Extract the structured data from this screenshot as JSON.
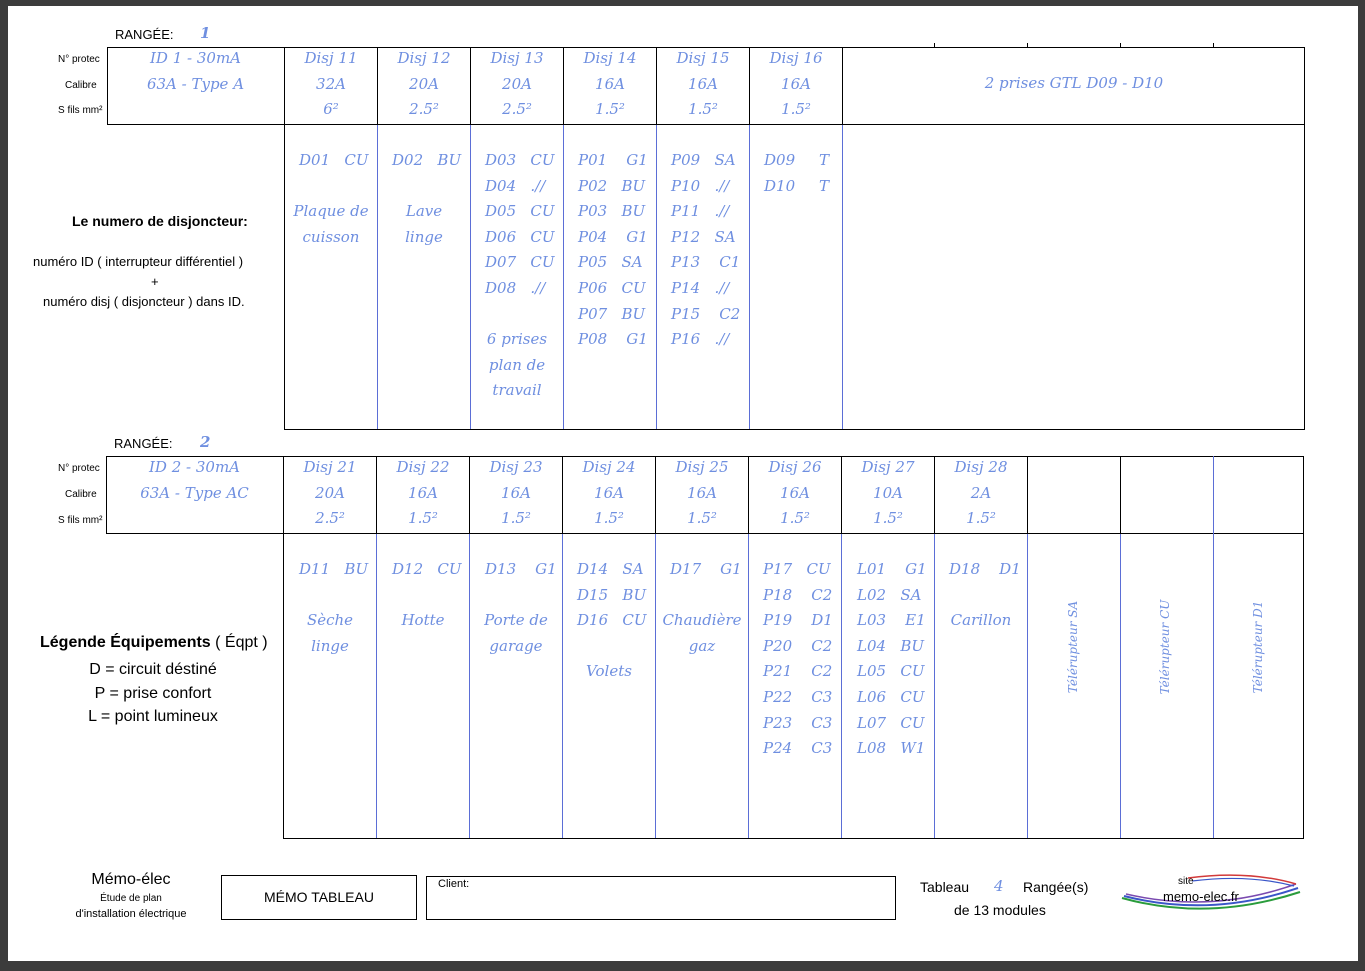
{
  "row1": {
    "label": "RANGÉE:",
    "number": "1",
    "side_labels": [
      "N° protec",
      "Calibre",
      "S fils mm²"
    ],
    "id_cell": [
      "ID 1  -  30mA",
      "63A  -  Type A"
    ],
    "breakers": [
      {
        "name": "Disj 11",
        "amp": "32A",
        "wire": "6²",
        "circuits": "D01   CU",
        "desc": "Plaque de\ncuisson"
      },
      {
        "name": "Disj 12",
        "amp": "20A",
        "wire": "2.5²",
        "circuits": "D02   BU",
        "desc": "Lave\nlinge"
      },
      {
        "name": "Disj 13",
        "amp": "20A",
        "wire": "2.5²",
        "circuits": "D03   CU\nD04   .//\nD05   CU\nD06   CU\nD07   CU\nD08   .//",
        "desc": "6 prises\nplan de\ntravail"
      },
      {
        "name": "Disj 14",
        "amp": "16A",
        "wire": "1.5²",
        "circuits": "P01    G1\nP02   BU\nP03   BU\nP04    G1\nP05   SA\nP06   CU\nP07   BU\nP08    G1",
        "desc": ""
      },
      {
        "name": "Disj 15",
        "amp": "16A",
        "wire": "1.5²",
        "circuits": "P09   SA\nP10   .//\nP11   .//\nP12   SA\nP13    C1\nP14   .//\nP15    C2\nP16   .//",
        "desc": ""
      },
      {
        "name": "Disj 16",
        "amp": "16A",
        "wire": "1.5²",
        "circuits": "D09     T\nD10     T",
        "desc": ""
      }
    ],
    "wide_cell": "2 prises GTL D09 - D10"
  },
  "row2": {
    "label": "RANGÉE:",
    "number": "2",
    "side_labels": [
      "N° protec",
      "Calibre",
      "S fils mm²"
    ],
    "id_cell": [
      "ID 2  -  30mA",
      "63A  -  Type AC"
    ],
    "breakers": [
      {
        "name": "Disj 21",
        "amp": "20A",
        "wire": "2.5²",
        "circuits": "D11   BU",
        "desc": "Sèche\nlinge"
      },
      {
        "name": "Disj 22",
        "amp": "16A",
        "wire": "1.5²",
        "circuits": "D12   CU",
        "desc": "Hotte"
      },
      {
        "name": "Disj 23",
        "amp": "16A",
        "wire": "1.5²",
        "circuits": "D13    G1",
        "desc": "Porte de\ngarage"
      },
      {
        "name": "Disj 24",
        "amp": "16A",
        "wire": "1.5²",
        "circuits": "D14   SA\nD15   BU\nD16   CU",
        "desc": "Volets"
      },
      {
        "name": "Disj 25",
        "amp": "16A",
        "wire": "1.5²",
        "circuits": "D17    G1",
        "desc": "Chaudière\ngaz"
      },
      {
        "name": "Disj 26",
        "amp": "16A",
        "wire": "1.5²",
        "circuits": "P17   CU\nP18    C2\nP19    D1\nP20    C2\nP21    C2\nP22    C3\nP23    C3\nP24    C3",
        "desc": ""
      },
      {
        "name": "Disj 27",
        "amp": "10A",
        "wire": "1.5²",
        "circuits": "L01    G1\nL02   SA\nL03    E1\nL04   BU\nL05   CU\nL06   CU\nL07   CU\nL08   W1",
        "desc": ""
      },
      {
        "name": "Disj 28",
        "amp": "2A",
        "wire": "1.5²",
        "circuits": "D18    D1",
        "desc": "Carillon"
      }
    ],
    "vertical_labels": [
      "Télérupteur SA",
      "Télérupteur CU",
      "Télérupteur D1"
    ]
  },
  "left_info": {
    "title": "Le numero de disjoncteur:",
    "line1": "numéro ID ( interrupteur différentiel )",
    "plus": "+",
    "line2": "numéro disj ( disjoncteur ) dans ID."
  },
  "legend": {
    "title_bold": "Légende Équipements",
    "title_rest": " ( Éqpt )",
    "items": [
      "D = circuit déstiné",
      "P = prise confort",
      "L = point lumineux"
    ]
  },
  "footer": {
    "brand": "Mémo-élec",
    "brand_sub1": "Étude de plan",
    "brand_sub2": "d'installation électrique",
    "box_title": "MÉMO TABLEAU",
    "client_label": "Client:",
    "tableau_label": "Tableau",
    "tableau_count": "4",
    "rangees_label": "Rangée(s)",
    "modules_label": "de 13 modules",
    "site_label": "site",
    "site_url": "memo-elec.fr"
  },
  "colors": {
    "ink": "#6f8fe0",
    "line_blue": "#5b6ed6"
  }
}
